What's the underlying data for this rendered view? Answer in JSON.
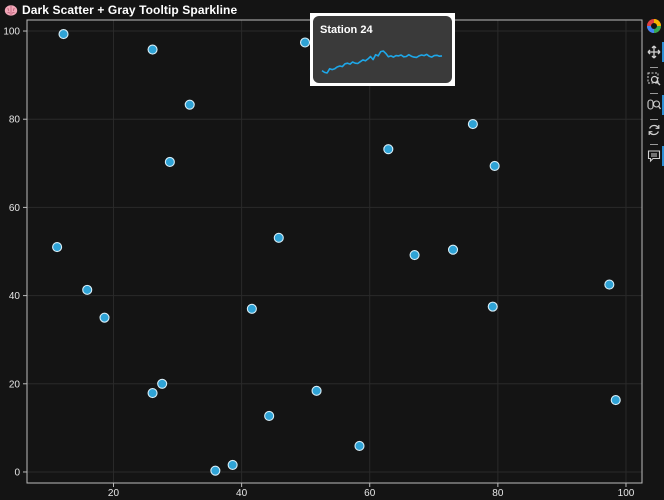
{
  "title": {
    "text": "Dark Scatter + Gray Tooltip Sparkline",
    "icon": "brain-icon"
  },
  "toolbar": {
    "tools": [
      "bokeh-logo-icon",
      "pan-icon",
      "box-zoom-icon",
      "wheel-zoom-icon",
      "reset-icon",
      "hover-icon"
    ]
  },
  "tooltip": {
    "title": "Station 24",
    "sparkline": [
      93,
      92.4,
      92.2,
      93.6,
      93.3,
      93.6,
      94.2,
      94.5,
      94.3,
      95.2,
      95.4,
      95.1,
      95.8,
      95.4,
      95.3,
      95.9,
      96.5,
      96.2,
      96.8,
      97.6,
      96.6,
      98.2,
      97.8,
      99.2,
      99.4,
      98.6,
      97.5,
      97.8,
      97.4,
      97.9,
      97.8,
      98.1,
      97.5,
      97.6,
      98.2,
      97.7,
      97.4,
      97.3,
      97.8,
      98.1,
      97.9,
      98.3,
      97.7,
      97.4,
      97.9,
      98.0,
      97.7,
      97.8
    ],
    "line_color": "#1ea7e8"
  },
  "colors": {
    "background": "#141414",
    "grid": "#2a2a2a",
    "axis": "#bbbbbb",
    "marker_fill": "#2fa3d6",
    "marker_stroke": "#d8eef8"
  },
  "chart_data": {
    "type": "scatter",
    "title": "Dark Scatter + Gray Tooltip Sparkline",
    "xlabel": "",
    "ylabel": "",
    "xlim": [
      6.5,
      102.5
    ],
    "ylim": [
      -2.5,
      102.5
    ],
    "xticks": [
      20,
      40,
      60,
      80,
      100
    ],
    "yticks": [
      0,
      20,
      40,
      60,
      80,
      100
    ],
    "grid": true,
    "points": [
      {
        "x": 12.2,
        "y": 99.3
      },
      {
        "x": 26.1,
        "y": 95.8
      },
      {
        "x": 31.9,
        "y": 83.3
      },
      {
        "x": 28.8,
        "y": 70.3
      },
      {
        "x": 11.2,
        "y": 51.0
      },
      {
        "x": 15.9,
        "y": 41.3
      },
      {
        "x": 18.6,
        "y": 35.0
      },
      {
        "x": 27.6,
        "y": 20.0
      },
      {
        "x": 26.1,
        "y": 17.9
      },
      {
        "x": 35.9,
        "y": 0.3
      },
      {
        "x": 38.6,
        "y": 1.6
      },
      {
        "x": 41.6,
        "y": 37.0
      },
      {
        "x": 45.8,
        "y": 53.1
      },
      {
        "x": 44.3,
        "y": 12.7
      },
      {
        "x": 49.9,
        "y": 97.4
      },
      {
        "x": 51.7,
        "y": 18.4
      },
      {
        "x": 58.4,
        "y": 5.9
      },
      {
        "x": 62.9,
        "y": 73.2
      },
      {
        "x": 67.0,
        "y": 49.2
      },
      {
        "x": 73.0,
        "y": 50.4
      },
      {
        "x": 76.1,
        "y": 78.9
      },
      {
        "x": 79.2,
        "y": 37.5
      },
      {
        "x": 79.5,
        "y": 69.4
      },
      {
        "x": 97.4,
        "y": 42.5
      },
      {
        "x": 98.4,
        "y": 16.3
      }
    ]
  }
}
